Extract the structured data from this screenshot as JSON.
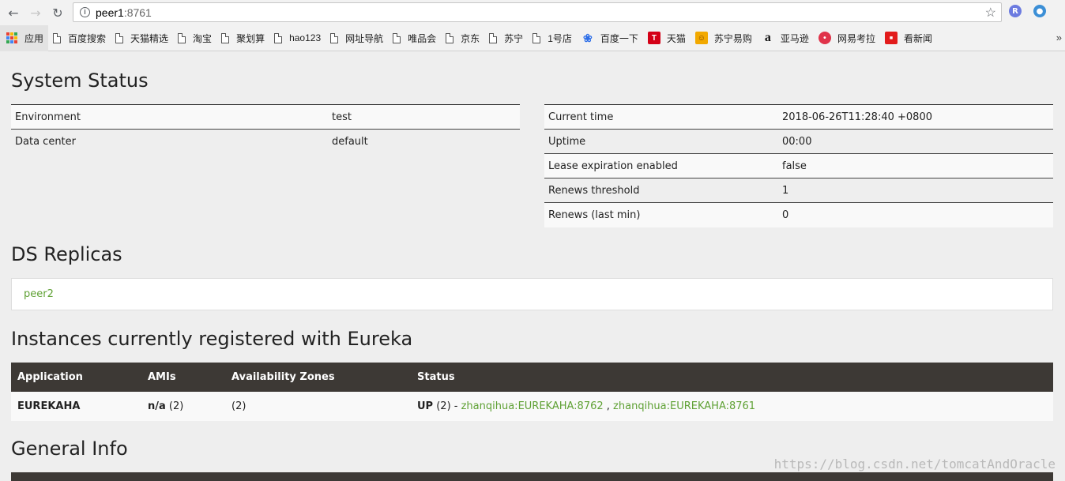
{
  "browser": {
    "url_host": "peer1",
    "url_port": ":8761",
    "bookmarks": [
      {
        "label": "应用",
        "icon": "apps-grid-icon"
      },
      {
        "label": "百度搜索",
        "icon": "page-icon"
      },
      {
        "label": "天猫精选",
        "icon": "page-icon"
      },
      {
        "label": "淘宝",
        "icon": "page-icon"
      },
      {
        "label": "聚划算",
        "icon": "page-icon"
      },
      {
        "label": "hao123",
        "icon": "page-icon"
      },
      {
        "label": "网址导航",
        "icon": "page-icon"
      },
      {
        "label": "唯品会",
        "icon": "page-icon"
      },
      {
        "label": "京东",
        "icon": "page-icon"
      },
      {
        "label": "苏宁",
        "icon": "page-icon"
      },
      {
        "label": "1号店",
        "icon": "page-icon"
      },
      {
        "label": "百度一下",
        "icon": "baidu-paw-icon"
      },
      {
        "label": "天猫",
        "icon": "tmall-icon"
      },
      {
        "label": "苏宁易购",
        "icon": "suning-icon"
      },
      {
        "label": "亚马逊",
        "icon": "amazon-icon"
      },
      {
        "label": "网易考拉",
        "icon": "kaola-icon"
      },
      {
        "label": "看新闻",
        "icon": "toutiao-icon"
      }
    ],
    "more_label": "»"
  },
  "system_status": {
    "title": "System Status",
    "left": [
      {
        "key": "Environment",
        "value": "test"
      },
      {
        "key": "Data center",
        "value": "default"
      }
    ],
    "right": [
      {
        "key": "Current time",
        "value": "2018-06-26T11:28:40 +0800"
      },
      {
        "key": "Uptime",
        "value": "00:00"
      },
      {
        "key": "Lease expiration enabled",
        "value": "false"
      },
      {
        "key": "Renews threshold",
        "value": "1"
      },
      {
        "key": "Renews (last min)",
        "value": "0"
      }
    ]
  },
  "replicas": {
    "title": "DS Replicas",
    "items": [
      "peer2"
    ]
  },
  "instances": {
    "title": "Instances currently registered with Eureka",
    "headers": [
      "Application",
      "AMIs",
      "Availability Zones",
      "Status"
    ],
    "rows": [
      {
        "application": "EUREKAHA",
        "amis_bold": "n/a",
        "amis_count": " (2)",
        "zones": "(2)",
        "status_bold": "UP",
        "status_count": " (2) - ",
        "links": [
          "zhanqihua:EUREKAHA:8762",
          "zhanqihua:EUREKAHA:8761"
        ],
        "link_sep": " , "
      }
    ]
  },
  "general_info": {
    "title": "General Info"
  },
  "watermark": "https://blog.csdn.net/tomcatAndOracle",
  "colors": {
    "link": "#5fa134",
    "table_header": "#3d3935",
    "page_bg": "#eeeeee"
  }
}
